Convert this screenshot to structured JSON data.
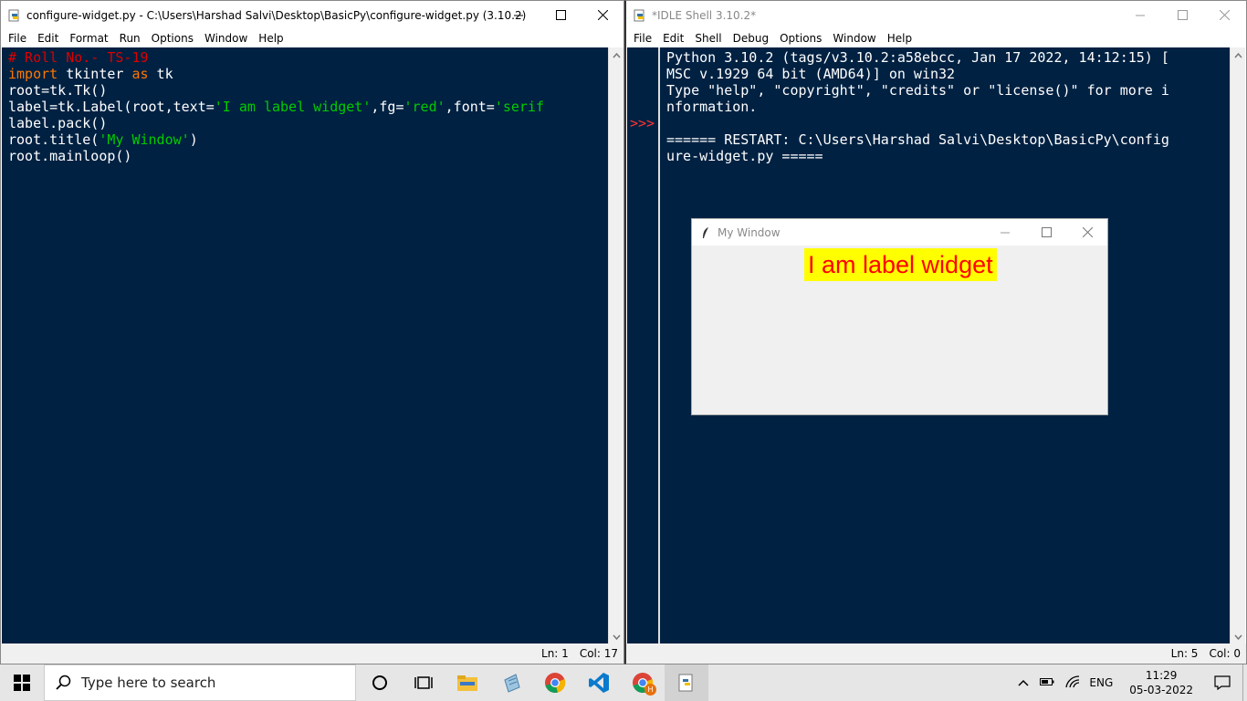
{
  "editor": {
    "title": "configure-widget.py - C:\\Users\\Harshad Salvi\\Desktop\\BasicPy\\configure-widget.py (3.10.2)",
    "menu": [
      "File",
      "Edit",
      "Format",
      "Run",
      "Options",
      "Window",
      "Help"
    ],
    "code": {
      "line1": "# Roll No.- TS-19",
      "line2_kw1": "import",
      "line2_mid": " tkinter ",
      "line2_kw2": "as",
      "line2_end": " tk",
      "line3": "root=tk.Tk()",
      "line4_a": "label=tk.Label(root,text=",
      "line4_s1": "'I am label widget'",
      "line4_b": ",fg=",
      "line4_s2": "'red'",
      "line4_c": ",font=",
      "line4_s3": "'serif",
      "line5": "label.pack()",
      "line6_a": "root.title(",
      "line6_s": "'My Window'",
      "line6_b": ")",
      "line7": "root.mainloop()"
    },
    "status": {
      "ln": "Ln: 1",
      "col": "Col: 17"
    }
  },
  "shell": {
    "title": "*IDLE Shell 3.10.2*",
    "menu": [
      "File",
      "Edit",
      "Shell",
      "Debug",
      "Options",
      "Window",
      "Help"
    ],
    "prompt": ">>>",
    "lines": [
      "Python 3.10.2 (tags/v3.10.2:a58ebcc, Jan 17 2022, 14:12:15) [",
      "MSC v.1929 64 bit (AMD64)] on win32",
      "Type \"help\", \"copyright\", \"credits\" or \"license()\" for more i",
      "nformation.",
      "",
      "====== RESTART: C:\\Users\\Harshad Salvi\\Desktop\\BasicPy\\config",
      "ure-widget.py ====="
    ],
    "status": {
      "ln": "Ln: 5",
      "col": "Col: 0"
    }
  },
  "tk_window": {
    "title": "My Window",
    "label_text": "I am label widget",
    "label_fg": "#ff0000",
    "label_bg": "#ffff00"
  },
  "taskbar": {
    "search_placeholder": "Type here to search",
    "icons": [
      "cortana-icon",
      "task-view-icon",
      "file-explorer-icon",
      "notepad-icon",
      "chrome-icon",
      "vscode-icon",
      "chrome-profile-icon",
      "python-idle-icon"
    ],
    "chrome_profile_badge": "H",
    "language": "ENG",
    "time": "11:29",
    "date": "05-03-2022"
  },
  "colors": {
    "editor_bg": "#002142",
    "comment": "#dd0000",
    "keyword": "#ff7700",
    "string": "#00cc00"
  }
}
